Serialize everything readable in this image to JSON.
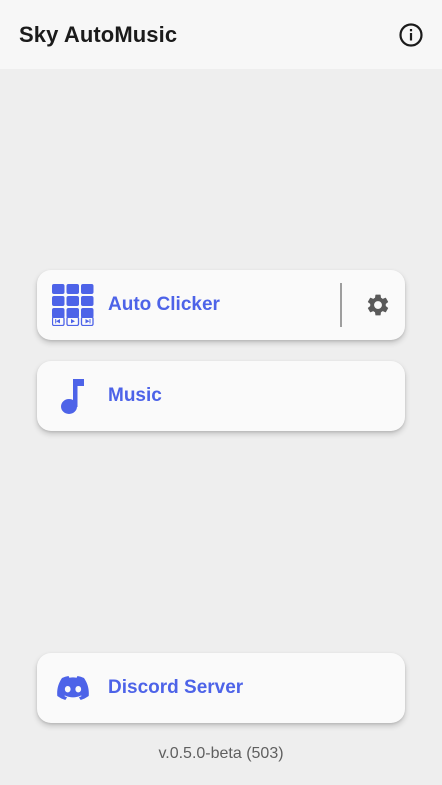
{
  "app_bar": {
    "title": "Sky AutoMusic",
    "info_icon": "info-circle-icon"
  },
  "menu": {
    "auto_clicker": {
      "label": "Auto Clicker",
      "icon": "keypad-grid-icon",
      "settings_icon": "gear-icon"
    },
    "music": {
      "label": "Music",
      "icon": "music-note-icon"
    }
  },
  "discord": {
    "label": "Discord Server",
    "icon": "discord-icon"
  },
  "footer": {
    "version": "v.0.5.0-beta (503)"
  },
  "colors": {
    "accent": "#4d63e8",
    "background": "#eeeeee",
    "card": "#fafafa",
    "app_bar": "#f7f7f7"
  }
}
